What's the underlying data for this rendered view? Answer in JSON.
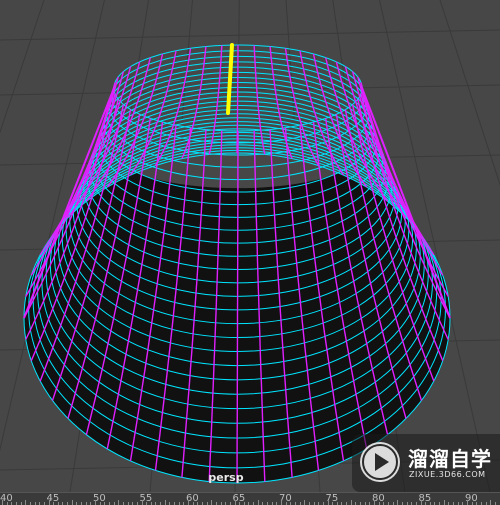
{
  "viewport": {
    "camera_label": "persp",
    "colors": {
      "background": "#474747",
      "grid_line": "#3a3a3a",
      "wireframe_lines": "#00e5ff",
      "wireframe_edges": "#e020ff",
      "selected_edge": "#ffff00"
    }
  },
  "watermark": {
    "name": "溜溜自学",
    "url": "ZIXUE.3D66.COM",
    "icon": "play-logo-icon"
  },
  "time_slider": {
    "labels": [
      "40",
      "45",
      "50",
      "55",
      "60",
      "65",
      "70",
      "75",
      "80",
      "85",
      "90"
    ]
  }
}
